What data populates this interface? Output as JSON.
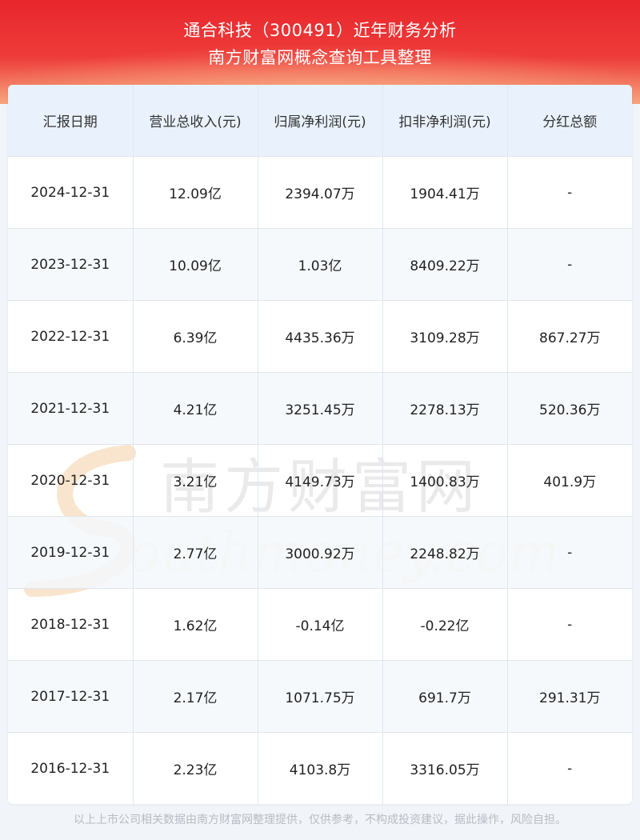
{
  "header": {
    "title_line1": "通合科技（300491）近年财务分析",
    "title_line2": "南方财富网概念查询工具整理"
  },
  "table": {
    "columns": [
      "汇报日期",
      "营业总收入(元)",
      "归属净利润(元)",
      "扣非净利润(元)",
      "分红总额"
    ],
    "rows": [
      [
        "2024-12-31",
        "12.09亿",
        "2394.07万",
        "1904.41万",
        "-"
      ],
      [
        "2023-12-31",
        "10.09亿",
        "1.03亿",
        "8409.22万",
        "-"
      ],
      [
        "2022-12-31",
        "6.39亿",
        "4435.36万",
        "3109.28万",
        "867.27万"
      ],
      [
        "2021-12-31",
        "4.21亿",
        "3251.45万",
        "2278.13万",
        "520.36万"
      ],
      [
        "2020-12-31",
        "3.21亿",
        "4149.73万",
        "1400.83万",
        "401.9万"
      ],
      [
        "2019-12-31",
        "2.77亿",
        "3000.92万",
        "2248.82万",
        "-"
      ],
      [
        "2018-12-31",
        "1.62亿",
        "-0.14亿",
        "-0.22亿",
        "-"
      ],
      [
        "2017-12-31",
        "2.17亿",
        "1071.75万",
        "691.7万",
        "291.31万"
      ],
      [
        "2016-12-31",
        "2.23亿",
        "4103.8万",
        "3316.05万",
        "-"
      ]
    ]
  },
  "watermark": {
    "cn": "南方财富网",
    "en": "outhmoney.com"
  },
  "footer": {
    "disclaimer": "以上上市公司相关数据由南方财富网整理提供，仅供参考，不构成投资建议，据此操作，风险自担。"
  }
}
